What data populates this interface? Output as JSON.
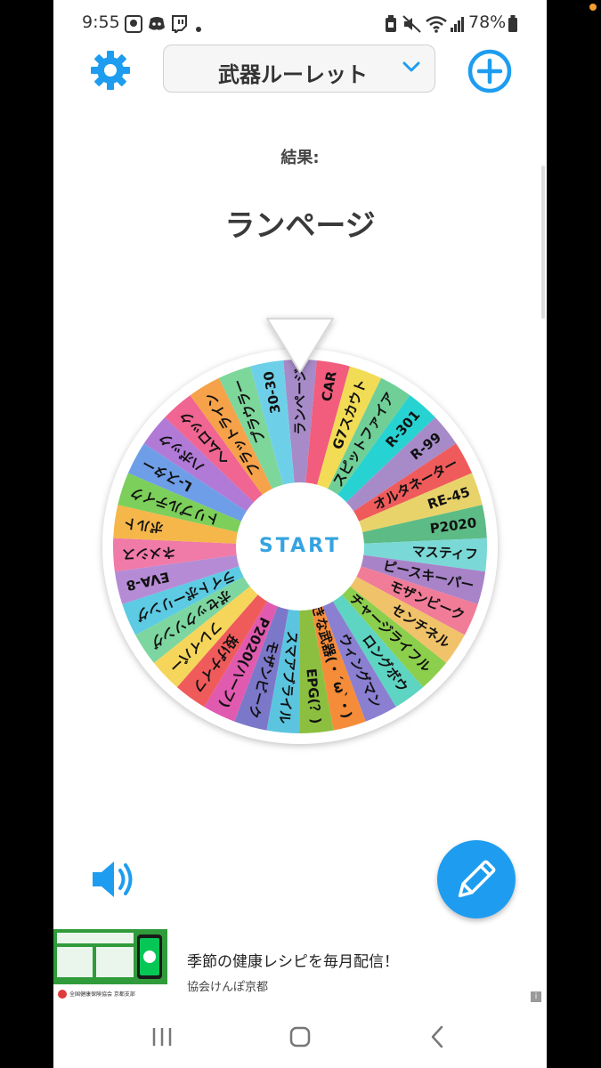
{
  "status_bar": {
    "time": "9:55",
    "battery": "78%",
    "icons": [
      "profile-icon",
      "discord-icon",
      "twitch-icon",
      "dot-icon",
      "battery-saver-icon",
      "mute-icon",
      "wifi-icon",
      "signal-icon",
      "battery-icon"
    ]
  },
  "header": {
    "settings_icon": "gear-icon",
    "title": "武器ルーレット",
    "dropdown_icon": "chevron-down-icon",
    "add_icon": "plus-circle-icon"
  },
  "result": {
    "label": "結果:",
    "value": "ランページ"
  },
  "wheel": {
    "start_label": "START",
    "pointer_icon": "pointer-triangle-icon",
    "segments": [
      {
        "label": "ランページ",
        "color": "#a78bc9"
      },
      {
        "label": "CAR",
        "color": "#f25c7d"
      },
      {
        "label": "G7スカウト",
        "color": "#f2dc55"
      },
      {
        "label": "スピットファイア",
        "color": "#6fcf97"
      },
      {
        "label": "R-301",
        "color": "#27d2d2"
      },
      {
        "label": "R-99",
        "color": "#a78bc9"
      },
      {
        "label": "オルタネーター",
        "color": "#ef5b5b"
      },
      {
        "label": "RE-45",
        "color": "#e8d36a"
      },
      {
        "label": "P2020",
        "color": "#5dbb85"
      },
      {
        "label": "マスティフ",
        "color": "#7ad9d6"
      },
      {
        "label": "ピースキーパー",
        "color": "#a883c8"
      },
      {
        "label": "モザンビーク",
        "color": "#f07c98"
      },
      {
        "label": "センチネル",
        "color": "#f0c36a"
      },
      {
        "label": "チャージライフル",
        "color": "#8ccf4d"
      },
      {
        "label": "ロングボウ",
        "color": "#5ed4c2"
      },
      {
        "label": "ウィングマン",
        "color": "#8a7fd1"
      },
      {
        "label": "好きな武器(・´ω`・)",
        "color": "#f58c3a"
      },
      {
        "label": "EPG(？)",
        "color": "#8cbf3f"
      },
      {
        "label": "スマアブライル",
        "color": "#5bc5e0"
      },
      {
        "label": "モザンビーク",
        "color": "#7c78c9"
      },
      {
        "label": "P2020(ハーフ)",
        "color": "#e05ab0"
      },
      {
        "label": "投げナイフ",
        "color": "#ef5b5b"
      },
      {
        "label": "フレイバー",
        "color": "#f5d55a"
      },
      {
        "label": "ボセックソング",
        "color": "#7dd6a0"
      },
      {
        "label": "ライトボーリング",
        "color": "#5ccbe3"
      },
      {
        "label": "EVA-8",
        "color": "#b58bd6"
      },
      {
        "label": "ネメシス",
        "color": "#f07aa8"
      },
      {
        "label": "ボルト",
        "color": "#f5b74a"
      },
      {
        "label": "トリプルテイク",
        "color": "#7ccf5a"
      },
      {
        "label": "L-スター",
        "color": "#6f9ee8"
      },
      {
        "label": "ハボック",
        "color": "#b07ad6"
      },
      {
        "label": "ヘムロック",
        "color": "#f06591"
      },
      {
        "label": "フラットライン",
        "color": "#f5a24a"
      },
      {
        "label": "プラウラー",
        "color": "#7dd69a"
      },
      {
        "label": "30-30",
        "color": "#6ed0e8"
      }
    ]
  },
  "controls": {
    "sound_icon": "speaker-icon",
    "edit_icon": "pencil-icon"
  },
  "ad": {
    "headline": "季節の健康レシピを毎月配信！",
    "sponsor": "協会けんぽ京都",
    "thumb_logo": "全国健康保険協会 京都支部",
    "info_label": "i"
  },
  "nav": {
    "recents_icon": "recents-icon",
    "home_icon": "home-icon",
    "back_icon": "back-icon"
  }
}
